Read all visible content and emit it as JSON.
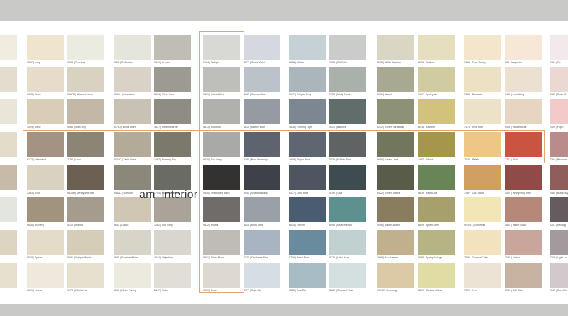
{
  "watermark": "am_interior",
  "highlight_color": "#e4a476",
  "columns": [
    {
      "rows": [
        {
          "color": "#f1ece0",
          "label": ""
        },
        {
          "color": "#e4dccc",
          "label": "ate"
        },
        {
          "color": "#eae5d9",
          "label": ""
        },
        {
          "color": "#e4dccb",
          "label": ""
        },
        {
          "color": "#c8baa8",
          "label": ""
        },
        {
          "color": "#e3e5df",
          "label": ""
        },
        {
          "color": "#ddd5c2",
          "label": ""
        },
        {
          "color": "#e7e0cf",
          "label": ""
        }
      ]
    },
    {
      "rows": [
        {
          "color": "#efe4cd",
          "label": "9567 | Ivory"
        },
        {
          "color": "#e6dcc9",
          "label": "9675 | Tenor"
        },
        {
          "color": "#d9cdb6",
          "label": "7049 | Sand"
        },
        {
          "color": "#a49282",
          "label": "9172 | Mercabolt"
        },
        {
          "color": "#d9d2c0",
          "label": "2363 | Solid"
        },
        {
          "color": "#a1937c",
          "label": "9626 | Burberg"
        },
        {
          "color": "#e4dcc9",
          "label": "9578 | Space"
        },
        {
          "color": "#eee9dc",
          "label": "9671 | Linear"
        }
      ]
    },
    {
      "rows": [
        {
          "color": "#ecebdf",
          "label": "9508 | Timeless"
        },
        {
          "color": "#d8d2c0",
          "label": "9867B | Washed Linen"
        },
        {
          "color": "#c3b8a6",
          "label": "9085 | Soft Grey"
        },
        {
          "color": "#8c8475",
          "label": "7252 | Laze"
        },
        {
          "color": "#6b6052",
          "label": "9826B | Vandyke Brown"
        },
        {
          "color": "#a69c8e",
          "label": "5320 | Walnut"
        },
        {
          "color": "#d6cdb9",
          "label": "5091 | Antique White"
        },
        {
          "color": "#e6e0cf",
          "label": "9476 | Witch Leaf"
        }
      ]
    },
    {
      "rows": [
        {
          "color": "#e5e5db",
          "label": "9522 | Reflection"
        },
        {
          "color": "#d8d3c6",
          "label": "9034H | Limestone"
        },
        {
          "color": "#c7c2b4",
          "label": "9076J | White Linen"
        },
        {
          "color": "#b3aa9a",
          "label": "9534D | Table Stone"
        },
        {
          "color": "#8c877b",
          "label": "9982D | Ocecom"
        },
        {
          "color": "#cfc7b3",
          "label": "9652 | Chino"
        },
        {
          "color": "#d8d4c8",
          "label": "9695 | Seaside White"
        },
        {
          "color": "#ece9df",
          "label": "8060 | White Parrey"
        }
      ]
    },
    {
      "rows": [
        {
          "color": "#c0bdb4",
          "label": "1549 | Cream"
        },
        {
          "color": "#9c9a91",
          "label": "8894 | Silver Tone"
        },
        {
          "color": "#8f8d83",
          "label": "1677 | Pebble Burner"
        },
        {
          "color": "#7b786c",
          "label": "1462 | Evening Sky"
        },
        {
          "color": "#6a6c64",
          "label": "1704 | Moss Meadow"
        },
        {
          "color": "#a9a39a",
          "label": "1262 | Iron Grey"
        },
        {
          "color": "#d9d6ce",
          "label": "1974 | Objection"
        },
        {
          "color": "#e0ded6",
          "label": "2347 | Slate"
        }
      ]
    },
    {
      "rows": [
        {
          "color": "#d8d8d4",
          "label": "9904 | Twilight"
        },
        {
          "color": "#bebebb",
          "label": "9891 | Oxford Mint"
        },
        {
          "color": "#b0b0ad",
          "label": "9871 | Platinum"
        },
        {
          "color": "#a9a9a7",
          "label": "8610 | Sov Grey"
        },
        {
          "color": "#333230",
          "label": "9500 | Shadowed Black"
        },
        {
          "color": "#6f6c6a",
          "label": "9872 | Midmil"
        },
        {
          "color": "#bfbcb6",
          "label": "5981 | Silver Moon"
        },
        {
          "color": "#ddd8d0",
          "label": "9571 | Boxel"
        }
      ]
    },
    {
      "rows": [
        {
          "color": "#d5d9df",
          "label": "4377 | Cloud Violet"
        },
        {
          "color": "#bcc2c9",
          "label": "4962 | Classic Blue"
        },
        {
          "color": "#959aa3",
          "label": "4810 | Marine Blue"
        },
        {
          "color": "#5e6370",
          "label": "4184 | Blue Harmony"
        },
        {
          "color": "#3e4248",
          "label": "4941 | Shadow Black"
        },
        {
          "color": "#9aa0a8",
          "label": "4626 | Mind Stem"
        },
        {
          "color": "#a8b4c1",
          "label": "4330 | Cardozee Blue"
        },
        {
          "color": "#d6dde3",
          "label": "4977 | Rain Sky"
        }
      ]
    },
    {
      "rows": [
        {
          "color": "#c6d1d6",
          "label": "6868 | Alfalfa"
        },
        {
          "color": "#aab5bc",
          "label": "6097 | Eclipse Grey"
        },
        {
          "color": "#7d8792",
          "label": "4638 | Evening Light"
        },
        {
          "color": "#5d6671",
          "label": "4699 | Stepin Blue"
        },
        {
          "color": "#4c5560",
          "label": "6477 | Citric Blue"
        },
        {
          "color": "#4a5c70",
          "label": "6625 | Trench"
        },
        {
          "color": "#6a8a9e",
          "label": "5706 | Retro Blue"
        },
        {
          "color": "#a8bcc6",
          "label": "6822 | Teal Zin"
        }
      ]
    },
    {
      "rows": [
        {
          "color": "#c9ccc8",
          "label": "7555 | Soft Mist"
        },
        {
          "color": "#aab0aa",
          "label": "7953 | Misty Breeze"
        },
        {
          "color": "#606d6a",
          "label": "5321 | Balance"
        },
        {
          "color": "#5f6364",
          "label": "5038 | N Path Blue"
        },
        {
          "color": "#3e4c50",
          "label": "5790 | Tola"
        },
        {
          "color": "#5f9090",
          "label": "6994 | Sea Emerald"
        },
        {
          "color": "#c1d0d0",
          "label": "5225 | Lake Haze"
        },
        {
          "color": "#d4e0df",
          "label": "5262 | Seaband Sea"
        }
      ]
    },
    {
      "rows": [
        {
          "color": "#d9d6c4",
          "label": "8265 | White Heather"
        },
        {
          "color": "#a9a991",
          "label": "8060 | Laurel"
        },
        {
          "color": "#8d9276",
          "label": "8212 | Green Hardaway"
        },
        {
          "color": "#71765c",
          "label": "8660 | Green Leaf"
        },
        {
          "color": "#5a5c4a",
          "label": "8422 | Green Marble"
        },
        {
          "color": "#897c5f",
          "label": "9096 | Olive Garden"
        },
        {
          "color": "#c0b08e",
          "label": "7998 | Sun Leaves"
        },
        {
          "color": "#dcc9a6",
          "label": "9004G | Ammang"
        }
      ]
    },
    {
      "rows": [
        {
          "color": "#e5dfc0",
          "label": "8216 | Nubbles"
        },
        {
          "color": "#d1cba0",
          "label": "9067 | Spring Air"
        },
        {
          "color": "#d2c27b",
          "label": "8278 | Raekim"
        },
        {
          "color": "#a4964b",
          "label": "1962 | Wheat"
        },
        {
          "color": "#698456",
          "label": "8519 | Palm Leaf"
        },
        {
          "color": "#a7a06c",
          "label": "8549 | Aprel Green"
        },
        {
          "color": "#b5b583",
          "label": "8568 | Spring Foliage"
        },
        {
          "color": "#e0dca4",
          "label": "8490 | Mellow Yellow"
        }
      ]
    },
    {
      "rows": [
        {
          "color": "#f3e6cb",
          "label": "7460 | Pure Harley"
        },
        {
          "color": "#ede1c4",
          "label": "7466 | Burlando"
        },
        {
          "color": "#ebe2c7",
          "label": "7473 | Wild Rice"
        },
        {
          "color": "#eec688",
          "label": "7742 | Petals"
        },
        {
          "color": "#cfa062",
          "label": "7687 | Oak Sand"
        },
        {
          "color": "#f3e6b6",
          "label": "9232C | Sunbread"
        },
        {
          "color": "#f2e2bd",
          "label": "7756 | Cheese Cake"
        },
        {
          "color": "#ede3d4",
          "label": "7402 | Hive"
        }
      ]
    },
    {
      "rows": [
        {
          "color": "#f6e7d6",
          "label": "564 | Magnolia"
        },
        {
          "color": "#ece0d0",
          "label": "7460 | Lunelicing"
        },
        {
          "color": "#e7d5c1",
          "label": "9008 | Woodstucks"
        },
        {
          "color": "#c95442",
          "label": "2387 | Bivil"
        },
        {
          "color": "#8f4c46",
          "label": "2400 | Whispering Red"
        },
        {
          "color": "#b5887a",
          "label": "2804 | Warm Black"
        },
        {
          "color": "#c9a69c",
          "label": "2030 | Umbra"
        },
        {
          "color": "#c8b3a3",
          "label": "5093 | Soft Skin"
        }
      ]
    },
    {
      "rows": [
        {
          "color": "#f2eaea",
          "label": "2764 | Pa"
        },
        {
          "color": "#ebd8d2",
          "label": "5189 | Rose M"
        },
        {
          "color": "#f3c9c9",
          "label": "2509 | Pupu"
        },
        {
          "color": "#b98c8c",
          "label": "2364 | Redwine"
        },
        {
          "color": "#8f5e5a",
          "label": "2084 | Burgundy"
        },
        {
          "color": "#665b5e",
          "label": "2207 | Redwig"
        },
        {
          "color": "#a29a9d",
          "label": "2206 | Light Lo"
        },
        {
          "color": "#d2c9cd",
          "label": "2047 | Coral Ar"
        }
      ]
    }
  ]
}
